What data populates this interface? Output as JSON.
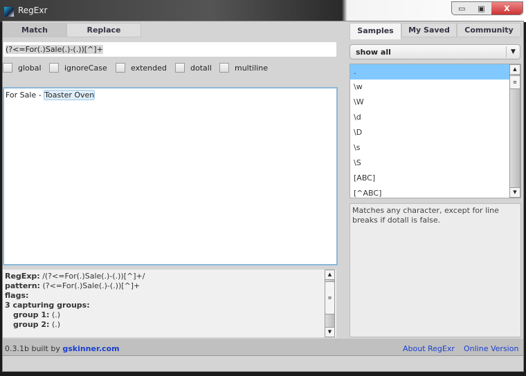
{
  "window": {
    "title": "RegExr",
    "controls": [
      "minimize",
      "maximize",
      "close"
    ]
  },
  "left": {
    "tabs": [
      {
        "label": "Match",
        "active": true
      },
      {
        "label": "Replace",
        "active": false
      }
    ],
    "regex_value": "(?<=For(.)Sale(.)-(.))[^]+",
    "flags": [
      {
        "label": "global",
        "checked": false
      },
      {
        "label": "ignoreCase",
        "checked": false
      },
      {
        "label": "extended",
        "checked": false
      },
      {
        "label": "dotall",
        "checked": false
      },
      {
        "label": "multiline",
        "checked": false
      }
    ],
    "text_before": "For Sale - ",
    "text_match": "Toaster Oven",
    "info": {
      "regexp_label": "RegExp:",
      "regexp_value": "/(?<=For(.)Sale(.)-(.))[^]+/",
      "pattern_label": "pattern:",
      "pattern_value": "(?<=For(.)Sale(.)-(.))[^]+",
      "flags_label": "flags:",
      "groups_label": "3 capturing groups:",
      "group1_label": "group 1:",
      "group1_value": "(.)",
      "group2_label": "group 2:",
      "group2_value": "(.)"
    }
  },
  "right": {
    "tabs": [
      {
        "label": "Samples",
        "active": true
      },
      {
        "label": "My Saved",
        "active": false
      },
      {
        "label": "Community",
        "active": false
      }
    ],
    "filter": "show all",
    "samples": [
      ".",
      "\\w",
      "\\W",
      "\\d",
      "\\D",
      "\\s",
      "\\S",
      "[ABC]",
      "[^ABC]"
    ],
    "selected_index": 0,
    "description": "Matches any character, except for line breaks if dotall is false."
  },
  "footer": {
    "version": "0.3.1b built by",
    "author_link": "gskinner.com",
    "about": "About RegExr",
    "online": "Online Version"
  },
  "colors": {
    "selection": "#80c8ff",
    "link": "#1a3fcf",
    "match_highlight": "#dfeefa"
  }
}
